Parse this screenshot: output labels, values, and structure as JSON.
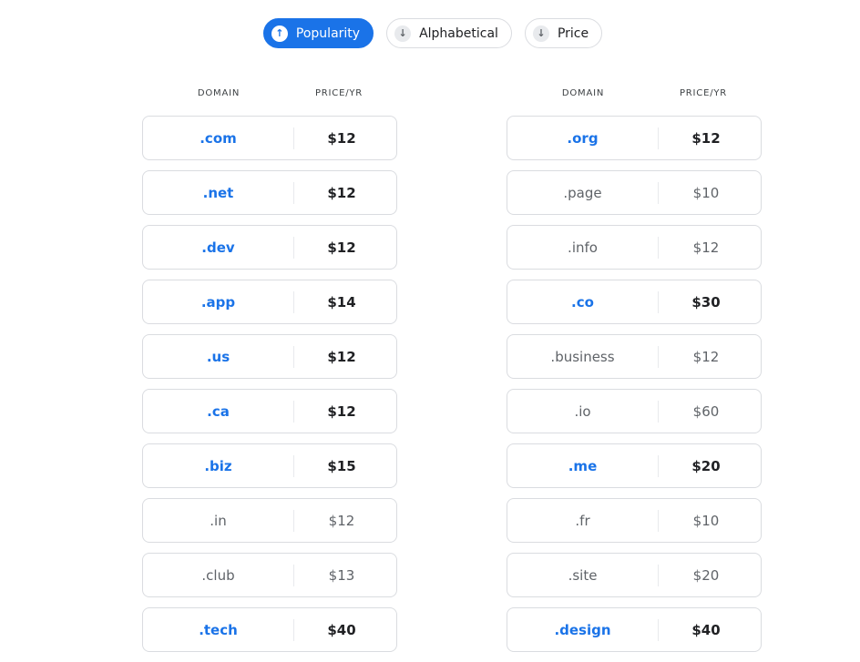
{
  "sort": {
    "options": [
      {
        "label": "Popularity",
        "icon": "arrow-up-icon",
        "glyph": "↑",
        "active": true
      },
      {
        "label": "Alphabetical",
        "icon": "arrow-down-icon",
        "glyph": "↓",
        "active": false
      },
      {
        "label": "Price",
        "icon": "arrow-down-icon",
        "glyph": "↓",
        "active": false
      }
    ]
  },
  "columns": {
    "domain_header": "DOMAIN",
    "price_header": "PRICE/YR"
  },
  "left": [
    {
      "domain": ".com",
      "price": "$12",
      "highlighted": true
    },
    {
      "domain": ".net",
      "price": "$12",
      "highlighted": true
    },
    {
      "domain": ".dev",
      "price": "$12",
      "highlighted": true
    },
    {
      "domain": ".app",
      "price": "$14",
      "highlighted": true
    },
    {
      "domain": ".us",
      "price": "$12",
      "highlighted": true
    },
    {
      "domain": ".ca",
      "price": "$12",
      "highlighted": true
    },
    {
      "domain": ".biz",
      "price": "$15",
      "highlighted": true
    },
    {
      "domain": ".in",
      "price": "$12",
      "highlighted": false
    },
    {
      "domain": ".club",
      "price": "$13",
      "highlighted": false
    },
    {
      "domain": ".tech",
      "price": "$40",
      "highlighted": true
    }
  ],
  "right": [
    {
      "domain": ".org",
      "price": "$12",
      "highlighted": true
    },
    {
      "domain": ".page",
      "price": "$10",
      "highlighted": false
    },
    {
      "domain": ".info",
      "price": "$12",
      "highlighted": false
    },
    {
      "domain": ".co",
      "price": "$30",
      "highlighted": true
    },
    {
      "domain": ".business",
      "price": "$12",
      "highlighted": false
    },
    {
      "domain": ".io",
      "price": "$60",
      "highlighted": false
    },
    {
      "domain": ".me",
      "price": "$20",
      "highlighted": true
    },
    {
      "domain": ".fr",
      "price": "$10",
      "highlighted": false
    },
    {
      "domain": ".site",
      "price": "$20",
      "highlighted": false
    },
    {
      "domain": ".design",
      "price": "$40",
      "highlighted": true
    }
  ]
}
